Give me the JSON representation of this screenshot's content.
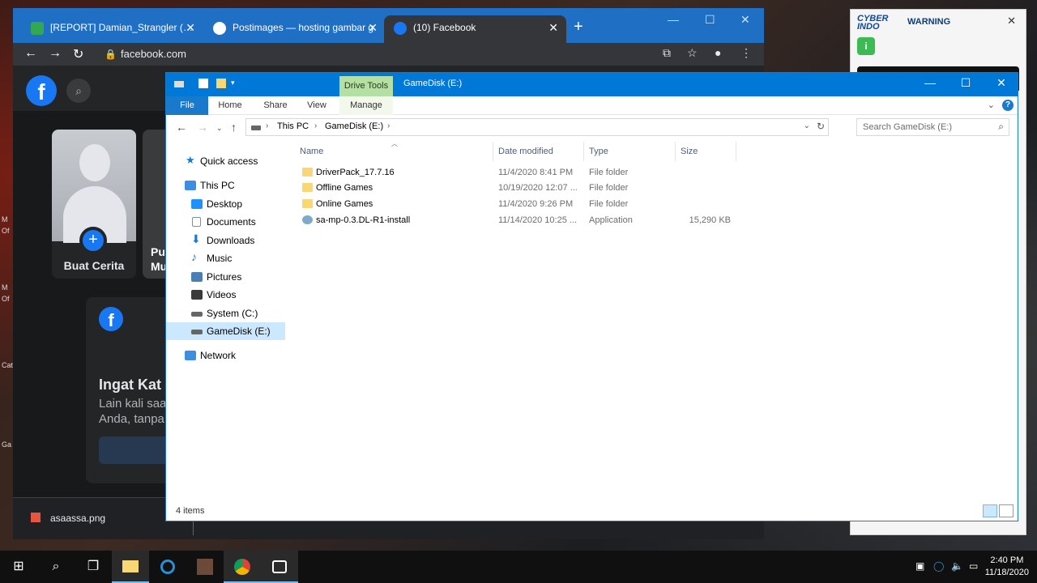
{
  "chrome": {
    "tabs": [
      {
        "label": "[REPORT] Damian_Strangler (Pos",
        "icon": "forum-icon",
        "color": "#32a852"
      },
      {
        "label": "Postimages — hosting gambar g",
        "icon": "postimages-icon",
        "color": "#1f6fc4"
      },
      {
        "label": "(10) Facebook",
        "icon": "facebook-icon",
        "color": "#1877f2"
      }
    ],
    "url": "facebook.com",
    "download": {
      "filename": "asaassa.png"
    }
  },
  "facebook": {
    "logo": "f",
    "story_create_label": "Buat Cerita",
    "story2_label": "Pu\nMu",
    "card_heading": "Ingat Kat",
    "card_text_1": "Lain kali saa",
    "card_text_2": "Anda, tanpa"
  },
  "cyber": {
    "logo_line1": "CYBER",
    "logo_line2": "INDO",
    "warning": "WARNING",
    "close": "✕"
  },
  "explorer": {
    "qa_title": "GameDisk (E:)",
    "context_tab": "Drive Tools",
    "ribbon_tabs": [
      "File",
      "Home",
      "Share",
      "View",
      "Manage"
    ],
    "breadcrumb": [
      "This PC",
      "GameDisk (E:)"
    ],
    "search_placeholder": "Search GameDisk (E:)",
    "nav": [
      {
        "label": "Quick access",
        "icon": "star-icon",
        "color": "#1979ca"
      },
      {
        "label": "This PC",
        "icon": "computer-icon",
        "color": "#3d8ee0"
      },
      {
        "label": "Desktop",
        "icon": "desktop-icon",
        "color": "#1e90ff"
      },
      {
        "label": "Documents",
        "icon": "documents-icon",
        "color": "#7a8ea8"
      },
      {
        "label": "Downloads",
        "icon": "downloads-icon",
        "color": "#1979ca"
      },
      {
        "label": "Music",
        "icon": "music-icon",
        "color": "#1979ca"
      },
      {
        "label": "Pictures",
        "icon": "pictures-icon",
        "color": "#4a7fb5"
      },
      {
        "label": "Videos",
        "icon": "videos-icon",
        "color": "#3a3a3a"
      },
      {
        "label": "System (C:)",
        "icon": "drive-icon",
        "color": "#666666"
      },
      {
        "label": "GameDisk (E:)",
        "icon": "drive-icon",
        "color": "#666666"
      },
      {
        "label": "Network",
        "icon": "network-icon",
        "color": "#3d8ee0"
      }
    ],
    "columns": [
      "Name",
      "Date modified",
      "Type",
      "Size"
    ],
    "files": [
      {
        "name": "DriverPack_17.7.16",
        "date": "11/4/2020 8:41 PM",
        "type": "File folder",
        "size": "",
        "icon": "folder-icon",
        "color": "#f8d775"
      },
      {
        "name": "Offline Games",
        "date": "10/19/2020 12:07 ...",
        "type": "File folder",
        "size": "",
        "icon": "folder-icon",
        "color": "#f8d775"
      },
      {
        "name": "Online Games",
        "date": "11/4/2020 9:26 PM",
        "type": "File folder",
        "size": "",
        "icon": "folder-icon",
        "color": "#f8d775"
      },
      {
        "name": "sa-mp-0.3.DL-R1-install",
        "date": "11/14/2020 10:25 ...",
        "type": "Application",
        "size": "15,290 KB",
        "icon": "installer-icon",
        "color": "#7fa8c9"
      }
    ],
    "status": "4 items"
  },
  "taskbar": {
    "time": "2:40 PM",
    "date": "11/18/2020"
  }
}
